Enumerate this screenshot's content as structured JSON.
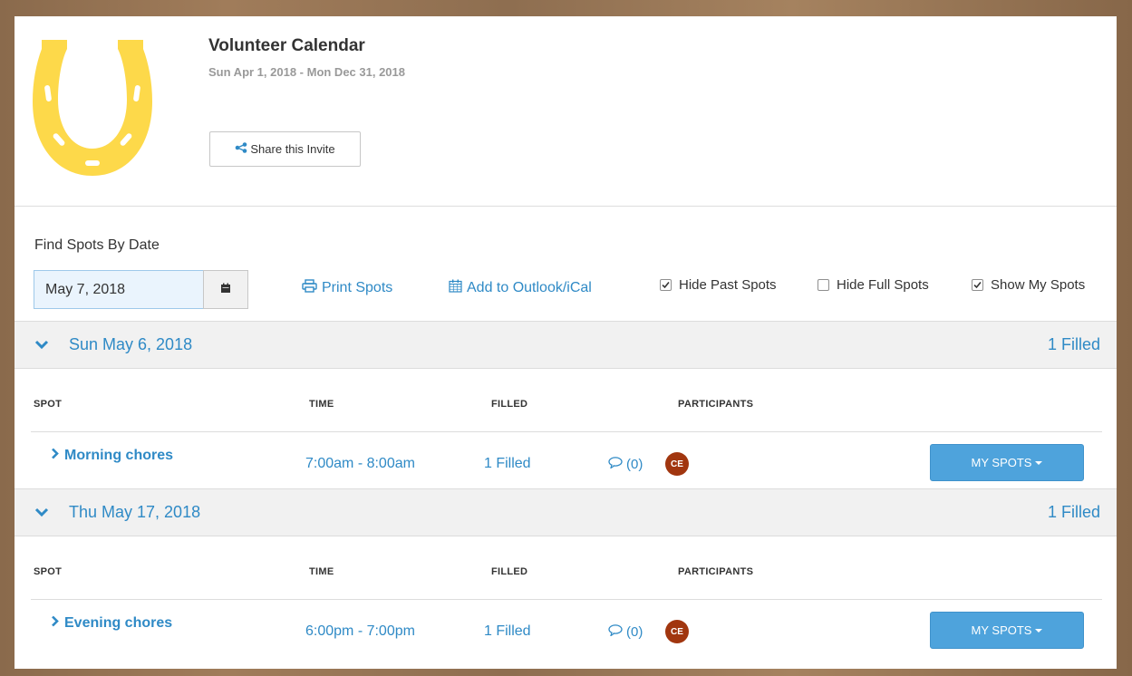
{
  "header": {
    "title": "Volunteer Calendar",
    "date_range": "Sun Apr 1, 2018 - Mon Dec 31, 2018",
    "share_label": "Share this Invite",
    "logo_color": "#fdd94a"
  },
  "filters": {
    "find_label": "Find Spots By Date",
    "date_value": "May 7, 2018",
    "print_label": "Print Spots",
    "outlook_label": "Add to Outlook/iCal",
    "hide_past_label": "Hide Past Spots",
    "hide_past_checked": true,
    "hide_full_label": "Hide Full Spots",
    "hide_full_checked": false,
    "show_my_label": "Show My Spots",
    "show_my_checked": true
  },
  "columns": {
    "spot": "SPOT",
    "time": "TIME",
    "filled": "FILLED",
    "participants": "PARTICIPANTS"
  },
  "groups": [
    {
      "date": "Sun May 6, 2018",
      "filled_summary": "1 Filled",
      "spot": {
        "name": "Morning chores",
        "time": "7:00am - 8:00am",
        "filled": "1 Filled",
        "comments": "(0)",
        "participant_initials": "CE",
        "action_label": "MY SPOTS"
      }
    },
    {
      "date": "Thu May 17, 2018",
      "filled_summary": "1 Filled",
      "spot": {
        "name": "Evening chores",
        "time": "6:00pm - 7:00pm",
        "filled": "1 Filled",
        "comments": "(0)",
        "participant_initials": "CE",
        "action_label": "MY SPOTS"
      }
    }
  ],
  "colors": {
    "link_blue": "#2f8ac6",
    "button_blue": "#4ea3dc",
    "avatar_bg": "#a1360f"
  }
}
